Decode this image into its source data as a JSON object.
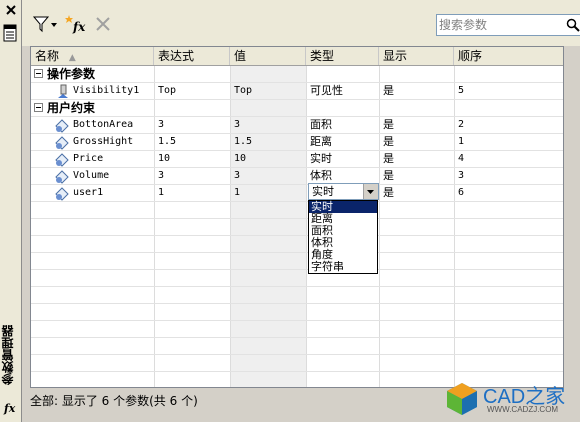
{
  "palette": {
    "header_bg": "#ece9d8",
    "selection": "#0a246a",
    "border": "#828790"
  },
  "panel": {
    "vertical_title": "参数管理器",
    "fx_label": "fx"
  },
  "toolbar": {
    "filter_icon": "filter-icon",
    "create_icon": "new-user-parameter-icon",
    "delete_icon": "delete-icon"
  },
  "search": {
    "placeholder": "搜索参数",
    "value": ""
  },
  "columns": [
    "名称",
    "表达式",
    "值",
    "类型",
    "显示",
    "顺序"
  ],
  "groups": [
    {
      "label": "操作参数",
      "rows": [
        {
          "name": "Visibility1",
          "expression": "Top",
          "value": "Top",
          "type": "可见性",
          "show": "是",
          "order": "5"
        }
      ]
    },
    {
      "label": "用户约束",
      "rows": [
        {
          "name": "BottonArea",
          "expression": "3",
          "value": "3",
          "type": "面积",
          "show": "是",
          "order": "2"
        },
        {
          "name": "GrossHight",
          "expression": "1.5",
          "value": "1.5",
          "type": "距离",
          "show": "是",
          "order": "1"
        },
        {
          "name": "Price",
          "expression": "10",
          "value": "10",
          "type": "实时",
          "show": "是",
          "order": "4"
        },
        {
          "name": "Volume",
          "expression": "3",
          "value": "3",
          "type": "体积",
          "show": "是",
          "order": "3"
        },
        {
          "name": "user1",
          "expression": "1",
          "value": "1",
          "type": "实时",
          "show": "是",
          "order": "6"
        }
      ]
    }
  ],
  "type_dropdown": {
    "selected": "实时",
    "options": [
      "实时",
      "距离",
      "面积",
      "体积",
      "角度",
      "字符串"
    ]
  },
  "status": {
    "text": "全部: 显示了 6 个参数(共 6 个)"
  },
  "watermark": {
    "brand": "CAD之家",
    "url": "WWW.CADZJ.COM"
  }
}
